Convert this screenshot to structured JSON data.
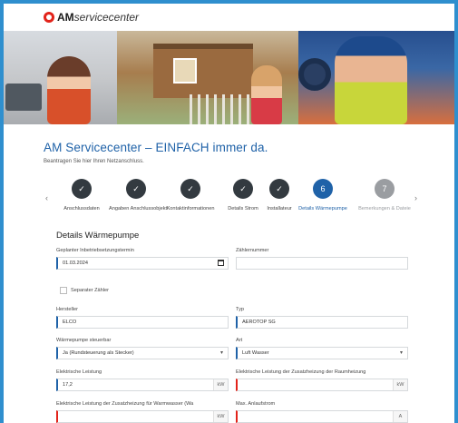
{
  "logo": {
    "prefix": "AM",
    "suffix": "servicecenter"
  },
  "title": "AM Servicecenter – EINFACH immer da.",
  "subtitle": "Beantragen Sie hier Ihren Netzanschluss.",
  "stepper": {
    "steps": [
      {
        "label": "Anschlussdaten",
        "state": "done",
        "marker": "✓"
      },
      {
        "label": "Angaben Anschlussobjekt",
        "state": "done",
        "marker": "✓"
      },
      {
        "label": "Kontaktinformationen",
        "state": "done",
        "marker": "✓"
      },
      {
        "label": "Details Strom",
        "state": "done",
        "marker": "✓"
      },
      {
        "label": "Installateur",
        "state": "done",
        "marker": "✓"
      },
      {
        "label": "Details Wärmepumpe",
        "state": "active",
        "marker": "6"
      },
      {
        "label": "Bemerkungen & Dateie",
        "state": "future",
        "marker": "7"
      }
    ],
    "prev": "‹",
    "next": "›"
  },
  "form": {
    "section_title": "Details Wärmepumpe",
    "geplanter_label": "Geplanter Inbetriebsetzungstermin",
    "geplanter_value": "01.03.2024",
    "zaehler_label": "Zählernummer",
    "zaehler_value": "",
    "separater_label": "Separater Zähler",
    "hersteller_label": "Hersteller",
    "hersteller_value": "ELCO",
    "typ_label": "Typ",
    "typ_value": "AEROTOP SG",
    "steuerbar_label": "Wärmepumpe steuerbar",
    "steuerbar_value": "Ja (Rundsteuerung als Stecker)",
    "art_label": "Art",
    "art_value": "Luft Wasser",
    "leistung_label": "Elektrische Leistung",
    "leistung_value": "17,2",
    "leistung_unit": "kW",
    "zusatz_raum_label": "Elektrische Leistung der Zusatzheizung der Raumheizung",
    "zusatz_raum_value": "",
    "zusatz_raum_unit": "kW",
    "zusatz_ww_label": "Elektrische Leistung der Zusatzheizung für Warmwasser (Wa",
    "zusatz_ww_value": "",
    "zusatz_ww_unit": "kW",
    "anlauf_label": "Max. Anlaufstrom",
    "anlauf_value": "",
    "anlauf_unit": "A"
  },
  "colors": {
    "brand": "#1f62a8",
    "logo_red": "#e2231a",
    "frame": "#2f8fce"
  }
}
